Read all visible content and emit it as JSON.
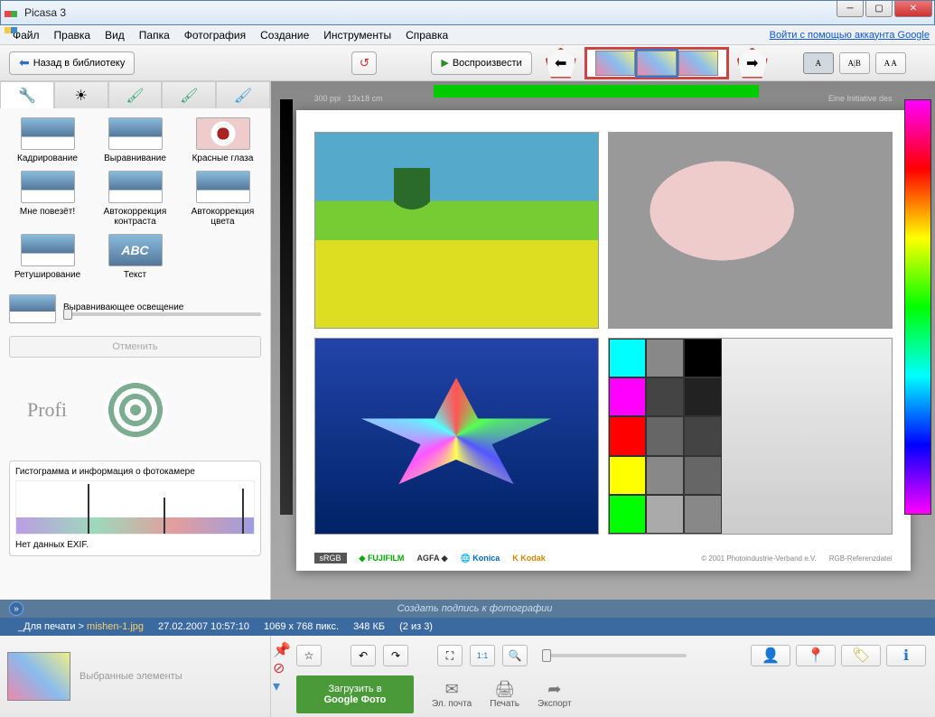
{
  "window": {
    "title": "Picasa 3"
  },
  "menu": {
    "items": [
      "Файл",
      "Правка",
      "Вид",
      "Папка",
      "Фотография",
      "Создание",
      "Инструменты",
      "Справка"
    ],
    "login_link": "Войти с помощью аккаунта Google"
  },
  "toolbar": {
    "back_label": "Назад в библиотеку",
    "play_label": "Воспроизвести",
    "view_modes": [
      "A",
      "A|B",
      "A A"
    ]
  },
  "tools": {
    "items": [
      {
        "label": "Кадрирование"
      },
      {
        "label": "Выравнивание"
      },
      {
        "label": "Красные глаза"
      },
      {
        "label": "Мне повезёт!"
      },
      {
        "label": "Автокоррекция контраста"
      },
      {
        "label": "Автокоррекция цвета"
      },
      {
        "label": "Ретуширование"
      },
      {
        "label": "Текст"
      }
    ],
    "fill_light_label": "Выравнивающее освещение",
    "undo_label": "Отменить"
  },
  "histogram": {
    "title": "Гистограмма и информация о фотокамере",
    "exif_status": "Нет данных EXIF."
  },
  "watermark": {
    "text": "Profi",
    "url": "profilirovanie.ru"
  },
  "page": {
    "ppi": "300 ppi",
    "size": "13x18 cm",
    "initiative": "Eine Initiative des",
    "brands": {
      "srgb": "sRGB",
      "fuji": "FUJIFILM",
      "agfa": "AGFA",
      "konica": "Konica",
      "kodak": "Kodak",
      "copyright": "© 2001 Photoindustrie-Verband e.V.",
      "ref": "RGB-Referenzdatei"
    }
  },
  "caption": {
    "placeholder": "Создать подпись к фотографии"
  },
  "path": {
    "folder": "_Для печати",
    "file": "mishen-1.jpg",
    "datetime": "27.02.2007 10:57:10",
    "dimensions": "1069 x 768 пикс.",
    "filesize": "348 КБ",
    "position": "(2 из 3)"
  },
  "selection": {
    "label": "Выбранные элементы"
  },
  "actions": {
    "upload_line1": "Загрузить в",
    "upload_line2": "Google Фото",
    "email": "Эл. почта",
    "print": "Печать",
    "export": "Экспорт"
  }
}
